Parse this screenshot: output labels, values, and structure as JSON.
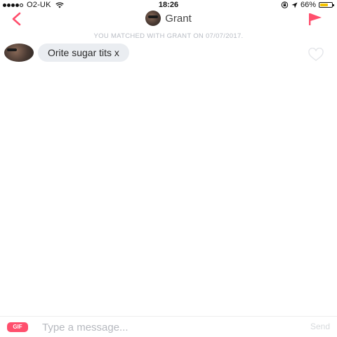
{
  "status_bar": {
    "carrier": "O2-UK",
    "signal_bars_filled": 4,
    "signal_bars_total": 5,
    "time": "18:26",
    "battery_percent": "66%",
    "battery_level": 0.66,
    "battery_color": "#f2c200",
    "icons": [
      "wifi-icon",
      "orientation-lock-icon",
      "location-arrow-icon",
      "battery-icon"
    ]
  },
  "nav": {
    "back_icon": "chevron-left-icon",
    "match_name": "Grant",
    "flag_icon": "flag-icon",
    "accent_color": "#ff4f6d"
  },
  "chat": {
    "matched_notice": "YOU MATCHED WITH GRANT ON 07/07/2017.",
    "messages": [
      {
        "text": "Orite sugar tits x",
        "sender": "Grant",
        "liked": false
      }
    ]
  },
  "compose": {
    "gif_label": "GIF",
    "placeholder": "Type a message...",
    "send_label": "Send"
  }
}
